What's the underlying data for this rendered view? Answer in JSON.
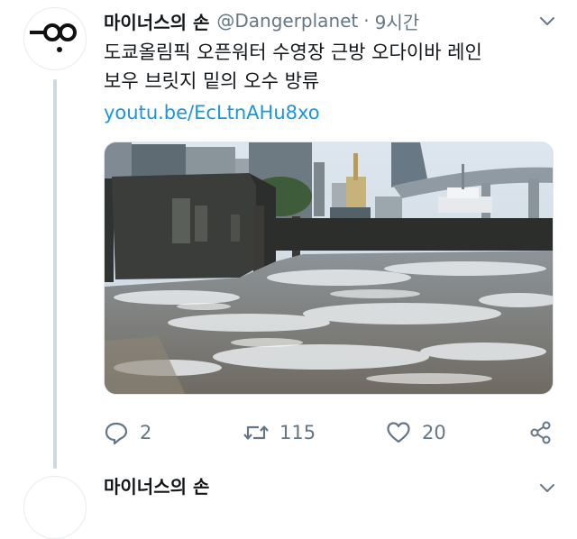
{
  "tweet": {
    "display_name": "마이너스의 손",
    "handle": "@Dangerplanet",
    "separator": "·",
    "time": "9시간",
    "text_lines": [
      "도쿄올림픽 오픈워터 수영장 근방 오다이바 레인",
      "보우 브릿지 밑의 오수 방류"
    ],
    "link": "youtu.be/EcLtnAHu8xo",
    "actions": {
      "reply_count": "2",
      "retweet_count": "115",
      "like_count": "20"
    }
  },
  "next_tweet": {
    "display_name": "마이너스의 손"
  },
  "icons": {
    "avatar": "avatar-logo-icon",
    "caret": "chevron-down-icon",
    "reply": "reply-icon",
    "retweet": "retweet-icon",
    "like": "heart-icon",
    "share": "share-icon"
  },
  "colors": {
    "text": "#14171a",
    "secondary": "#657786",
    "link": "#1b95e0",
    "thread_line": "#cfd9de"
  }
}
